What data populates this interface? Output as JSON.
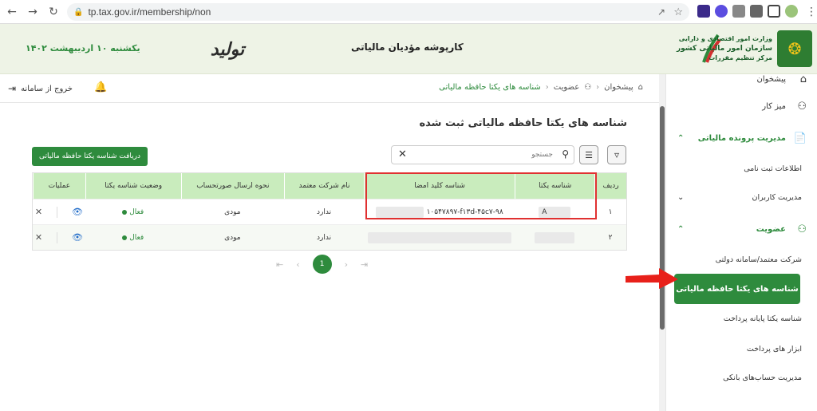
{
  "browser": {
    "url": "tp.tax.gov.ir/membership/non",
    "back_icon": "arrow-left",
    "forward_icon": "arrow-right",
    "reload_icon": "reload"
  },
  "header": {
    "date": "یکشنبه ۱۰ اردیبهشت ۱۴۰۲",
    "slogan": "تولید",
    "title": "کارپوشه مؤدیان مالیاتی",
    "org_line1": "وزارت امور اقتصادی و دارایی",
    "org_line2": "سازمان امور مالیاتی کشور",
    "org_line3": "مرکز تنظیم مقررات"
  },
  "toolbar": {
    "logout_label": "خروج از سامانه",
    "breadcrumb": [
      "پیشخوان",
      "عضویت",
      "شناسه های یکتا حافظه مالیاتی"
    ]
  },
  "main": {
    "page_title": "شناسه های یکتا حافظه مالیاتی ثبت شده",
    "request_button": "دریافت شناسه یکتا حافظه مالیاتی",
    "search_placeholder": "جستجو",
    "table": {
      "headers": [
        "ردیف",
        "شناسه یکتا",
        "شناسه کلید امضا",
        "نام شرکت معتمد",
        "نحوه ارسال صورتحساب",
        "وضعیت شناسه یکتا",
        "عملیات"
      ],
      "rows": [
        {
          "index": "۱",
          "id": "A",
          "key": "۱۰۵۴۷۸۹۷-f۱۳d-۴۵c۷-۹۸",
          "company": "ندارد",
          "send": "مودی",
          "status": "فعال"
        },
        {
          "index": "۲",
          "id": "",
          "key": "",
          "company": "ندارد",
          "send": "مودی",
          "status": "فعال"
        }
      ]
    },
    "pagination": {
      "current": "1"
    }
  },
  "sidebar": {
    "items": [
      {
        "label": "پیشخوان",
        "type": "item"
      },
      {
        "label": "میز کار",
        "type": "item"
      },
      {
        "label": "مدیریت پرونده مالیاتی",
        "type": "group"
      },
      {
        "label": "اطلاعات ثبت نامی",
        "type": "sub"
      },
      {
        "label": "مدیریت کاربران",
        "type": "sub"
      },
      {
        "label": "عضویت",
        "type": "group"
      },
      {
        "label": "شرکت معتمد/سامانه دولتی",
        "type": "sub"
      },
      {
        "label": "شناسه های یکتا حافظه مالیاتی",
        "type": "active"
      },
      {
        "label": "شناسه یکتا پایانه پرداخت",
        "type": "sub"
      },
      {
        "label": "ابزار های پرداخت",
        "type": "sub"
      },
      {
        "label": "مدیریت حساب‌های بانکی",
        "type": "sub"
      }
    ]
  },
  "colors": {
    "primary_green": "#2e8b3d",
    "table_header": "#c9ecbd",
    "highlight_red": "#e03131"
  }
}
